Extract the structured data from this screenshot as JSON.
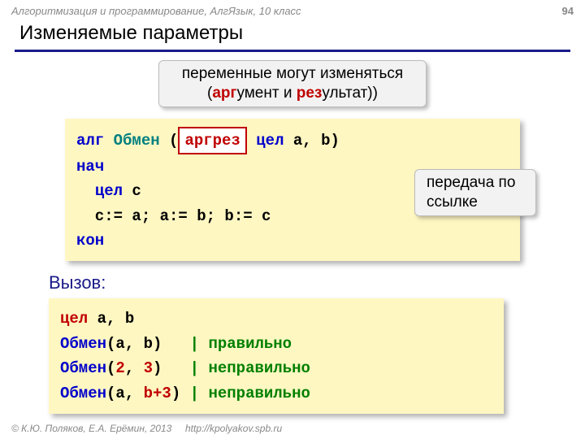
{
  "header": {
    "course": "Алгоритмизация и программирование, АлгЯзык, 10 класс",
    "pageNum": "94"
  },
  "title": "Изменяемые параметры",
  "callout1": {
    "line1_pre": "переменные могут изменяться",
    "line2_open": "(",
    "line2_arg_red": "арг",
    "line2_arg_rest": "умент и ",
    "line2_res_red": "рез",
    "line2_res_rest": "ультат)",
    "line2_close": ""
  },
  "code1": {
    "alg": "алг",
    "name": "Обмен",
    "paren_open": " (",
    "argres": "аргрез",
    "type": " цел",
    "params": " a, b)",
    "begin": "нач",
    "decl_kw": "цел",
    "decl_var": " c",
    "body": "  c:= a; a:= b; b:= c",
    "end": "кон"
  },
  "callout2": {
    "line1": "передача по",
    "line2": "ссылке"
  },
  "callLabel": "Вызов:",
  "code2": {
    "decl_kw": "цел",
    "decl_vars": " a, b",
    "l1_name": "Обмен",
    "l1_args": "(a, b)",
    "l1_pad": "   ",
    "l1_bar": "|",
    "l1_cmt": " правильно",
    "l2_name": "Обмен",
    "l2_open": "(",
    "l2_a1": "2",
    "l2_sep": ", ",
    "l2_a2": "3",
    "l2_close": ")",
    "l2_pad": "   ",
    "l2_bar": "|",
    "l2_cmt": " неправильно",
    "l3_name": "Обмен",
    "l3_open": "(a, ",
    "l3_a2": "b+3",
    "l3_close": ")",
    "l3_pad": " ",
    "l3_bar": "|",
    "l3_cmt": " неправильно"
  },
  "footer": {
    "copy": "© К.Ю. Поляков, Е.А. Ерёмин, 2013",
    "url": "http://kpolyakov.spb.ru"
  }
}
